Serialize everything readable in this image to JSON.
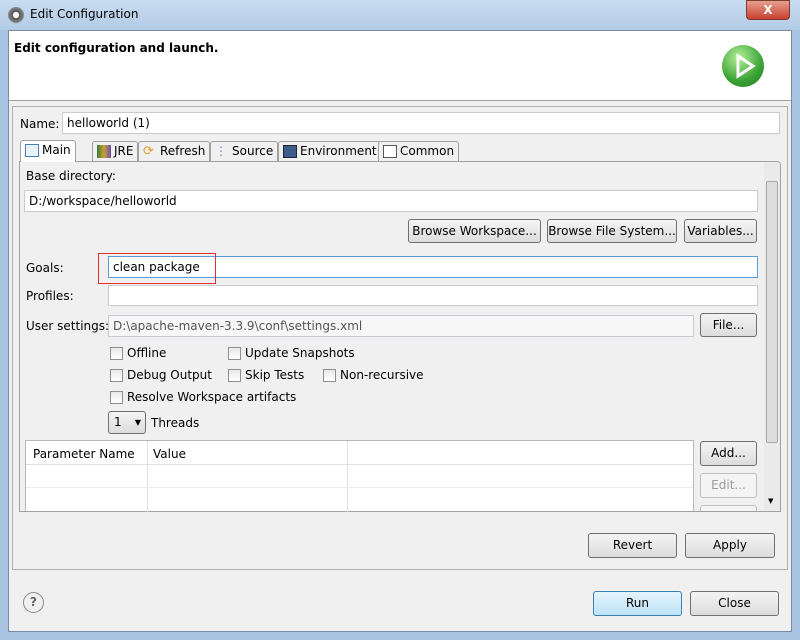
{
  "window": {
    "title": "Edit Configuration",
    "close_label": "X"
  },
  "header": {
    "title": "Edit configuration and launch."
  },
  "name": {
    "label": "Name:",
    "value": "helloworld (1)"
  },
  "tabs": [
    {
      "label": "Main",
      "active": true
    },
    {
      "label": "JRE"
    },
    {
      "label": "Refresh"
    },
    {
      "label": "Source"
    },
    {
      "label": "Environment"
    },
    {
      "label": "Common"
    }
  ],
  "main": {
    "base_directory_label": "Base directory:",
    "base_directory_value": "D:/workspace/helloworld",
    "browse_workspace": "Browse Workspace...",
    "browse_file_system": "Browse File System...",
    "variables": "Variables...",
    "goals_label": "Goals:",
    "goals_value": "clean package",
    "profiles_label": "Profiles:",
    "profiles_value": "",
    "user_settings_label": "User settings:",
    "user_settings_value": "D:\\apache-maven-3.3.9\\conf\\settings.xml",
    "file_button": "File...",
    "checkboxes": {
      "offline": "Offline",
      "update_snapshots": "Update Snapshots",
      "debug_output": "Debug Output",
      "skip_tests": "Skip Tests",
      "non_recursive": "Non-recursive",
      "resolve_workspace": "Resolve Workspace artifacts"
    },
    "threads_value": "1",
    "threads_label": "Threads",
    "table": {
      "columns": [
        "Parameter Name",
        "Value"
      ]
    },
    "add_button": "Add...",
    "edit_button": "Edit..."
  },
  "buttons": {
    "revert": "Revert",
    "apply": "Apply",
    "run": "Run",
    "close": "Close"
  },
  "colors": {
    "highlight_box": "#e03030",
    "run_green": "#3aa335"
  }
}
